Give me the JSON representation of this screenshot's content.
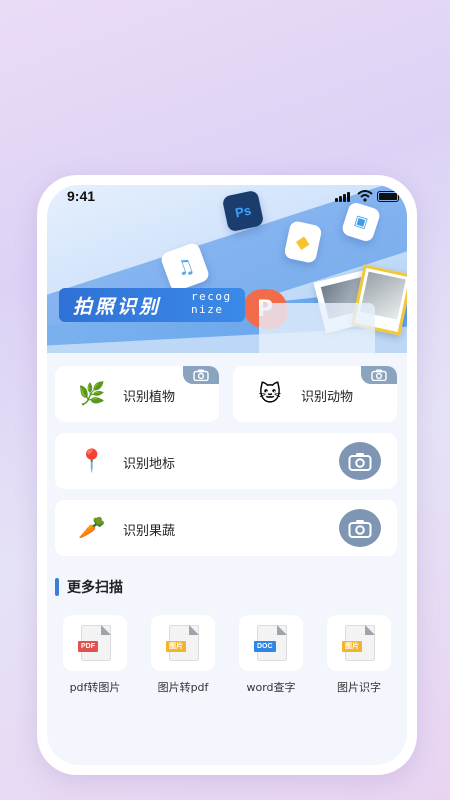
{
  "status_bar": {
    "time": "9:41"
  },
  "banner": {
    "title": "拍照识别",
    "subtitle_line1": "recog",
    "subtitle_line2": "nize",
    "ps_icon_text": "Ps",
    "bubble_text": "P"
  },
  "recognize": {
    "plant": {
      "label": "识别植物",
      "emoji": "🌿"
    },
    "animal": {
      "label": "识别动物",
      "emoji": "🐱"
    },
    "landmark": {
      "label": "识别地标",
      "emoji": "📍"
    },
    "fruit": {
      "label": "识别果蔬",
      "emoji": "🥕"
    }
  },
  "more_scan": {
    "title": "更多扫描",
    "tools": [
      {
        "label": "pdf转图片",
        "tag": "PDF",
        "tag_color": "#e05252"
      },
      {
        "label": "图片转pdf",
        "tag": "图片",
        "tag_color": "#f5b427"
      },
      {
        "label": "word查字",
        "tag": "DOC",
        "tag_color": "#2e86e6"
      },
      {
        "label": "图片识字",
        "tag": "图片",
        "tag_color": "#f5b427"
      }
    ]
  },
  "colors": {
    "accent": "#3a7fd8",
    "camera_button": "#7e96b4",
    "banner_blue": "#2f71d6"
  }
}
